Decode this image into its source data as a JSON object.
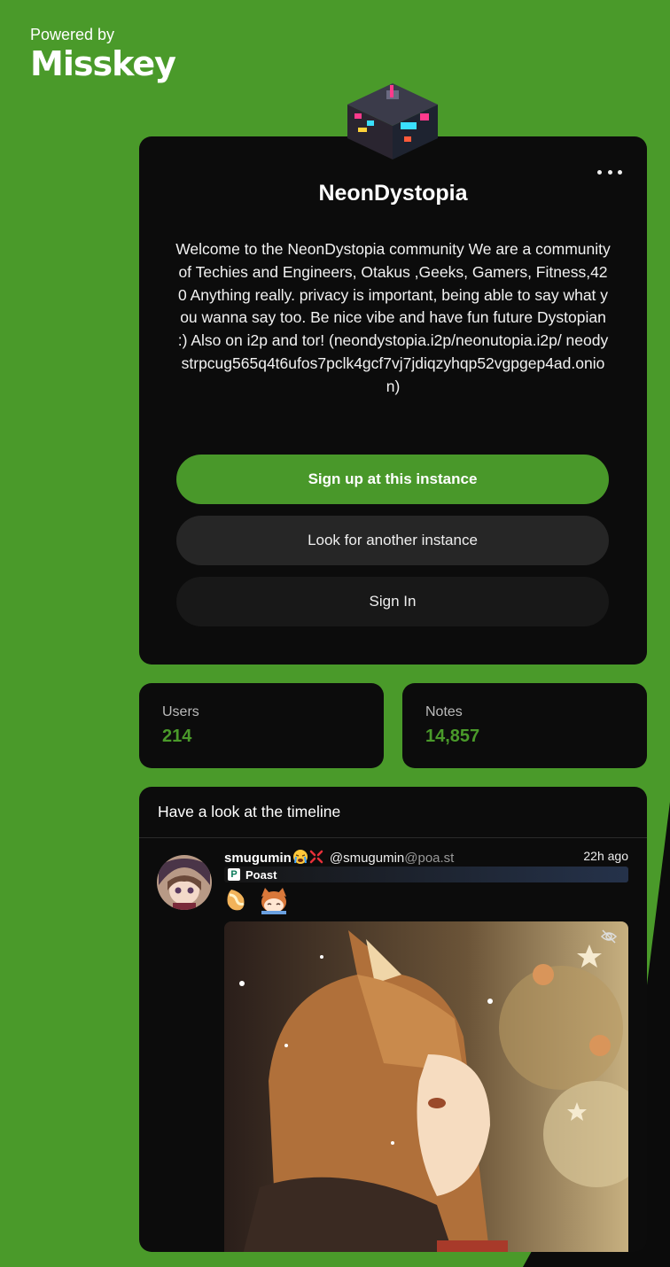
{
  "branding": {
    "powered_by": "Powered by",
    "logo_text": "Misskey"
  },
  "instance": {
    "name": "NeonDystopia",
    "description": "Welcome to the NeonDystopia community We are a community of Techies and Engineers, Otakus ,Geeks, Gamers, Fitness,420 Anything really. privacy is important, being able to say what you wanna say too. Be nice vibe and have fun future Dystopian :) Also on i2p and tor! (neondystopia.i2p/neonutopia.i2p/ neodystrpcug565q4t6ufos7pclk4gcf7vj7jdiqzyhqp52vgpgep4ad.onion)",
    "icon": "pixel-building-icon",
    "accent_color": "#4a9a2a"
  },
  "actions": {
    "signup_label": "Sign up at this instance",
    "explore_label": "Look for another instance",
    "signin_label": "Sign In"
  },
  "stats": {
    "users_label": "Users",
    "users_value": "214",
    "notes_label": "Notes",
    "notes_value": "14,857"
  },
  "timeline": {
    "title": "Have a look at the timeline",
    "note": {
      "display_name": "smugumin",
      "name_emojis": [
        "crying-emoji",
        "anger-emoji"
      ],
      "username": "@smugumin",
      "host": "@poa.st",
      "time": "22h ago",
      "instance_ticker": "Poast",
      "content_emojis": [
        "bread-emoji",
        "catgirl-emoji"
      ],
      "media_hidden_icon": "eye-slash-icon"
    }
  }
}
